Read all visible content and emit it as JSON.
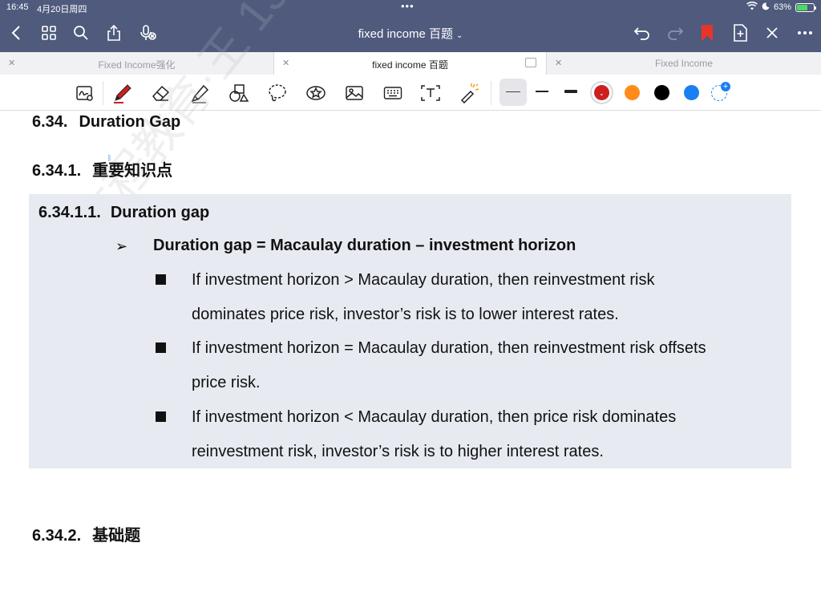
{
  "status_bar": {
    "time": "16:45",
    "date": "4月20日周四",
    "battery": "63%",
    "battery_level": 0.63
  },
  "nav": {
    "title": "fixed income 百题",
    "icons": [
      "chevron-left-icon",
      "grid-icon",
      "search-icon",
      "share-icon",
      "mic-off-icon",
      "undo-icon",
      "redo-icon",
      "bookmark-icon",
      "add-page-icon",
      "close-icon",
      "more-icon"
    ]
  },
  "tabs": [
    {
      "label": "Fixed Income强化",
      "active": false
    },
    {
      "label": "fixed income 百题",
      "active": true
    },
    {
      "label": "Fixed Income",
      "active": false
    }
  ],
  "toolbar": {
    "tools": [
      "lasso-handwriting-icon",
      "pen-icon",
      "eraser-icon",
      "highlighter-icon",
      "shapes-icon",
      "lasso-icon",
      "sticker-icon",
      "image-icon",
      "keyboard-icon",
      "text-box-icon",
      "laser-pointer-icon"
    ],
    "colors": {
      "red": "#cc1f1f",
      "orange": "#ff8c1a",
      "black": "#000000",
      "blue": "#1a7ff0",
      "accent": "#4f5a7d"
    }
  },
  "document": {
    "section": {
      "number": "6.34.",
      "title": "Duration Gap"
    },
    "subsection1": {
      "number": "6.34.1.",
      "title": "重要知识点"
    },
    "box": {
      "heading": {
        "number": "6.34.1.1.",
        "title": "Duration gap"
      },
      "formula": "Duration gap = Macaulay duration – investment horizon",
      "points": [
        {
          "line1": "If investment horizon > Macaulay duration, then reinvestment risk",
          "line2": "dominates price risk, investor’s risk is to lower interest rates."
        },
        {
          "line1": "If investment horizon = Macaulay duration, then reinvestment risk offsets",
          "line2": "price risk."
        },
        {
          "line1": "If investment horizon < Macaulay duration, then price risk dominates",
          "line2": "reinvestment risk, investor’s risk is to higher interest rates."
        }
      ]
    },
    "subsection2": {
      "number": "6.34.2.",
      "title": "基础题"
    },
    "watermark": "文程教育·王 13623559"
  }
}
